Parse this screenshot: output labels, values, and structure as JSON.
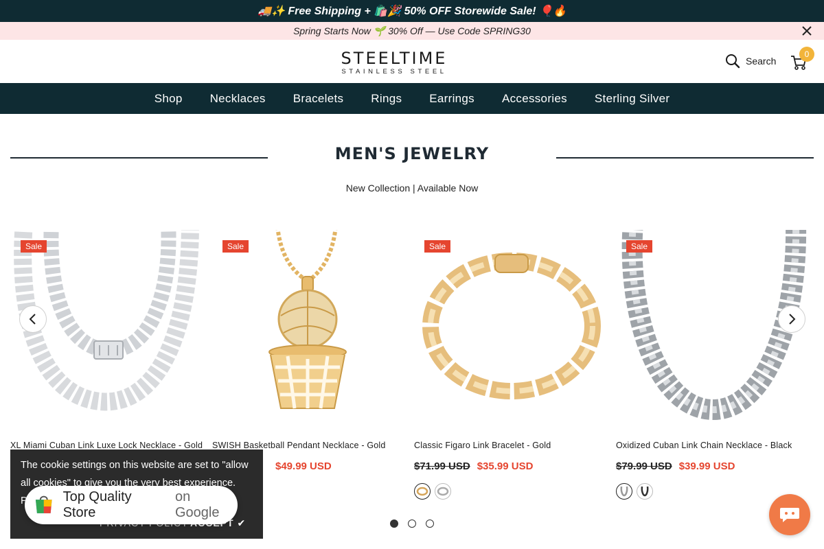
{
  "announcement": {
    "text": "🚚✨ Free Shipping + 🛍️🎉 50% OFF Storewide Sale! 🎈🔥"
  },
  "promo": {
    "text": "Spring Starts Now 🌱 30% Off — Use Code SPRING30"
  },
  "header": {
    "logo_main": "STEELTIME",
    "logo_sub": "STAINLESS STEEL",
    "search_label": "Search",
    "cart_count": "0"
  },
  "nav": {
    "items": [
      "Shop",
      "Necklaces",
      "Bracelets",
      "Rings",
      "Earrings",
      "Accessories",
      "Sterling Silver"
    ]
  },
  "section": {
    "title": "MEN'S JEWELRY",
    "subtitle": "New Collection | Available Now"
  },
  "products": [
    {
      "badge": "Sale",
      "name": "XL Miami Cuban Link Luxe Lock Necklace - Gold",
      "old_price": "",
      "new_price": ""
    },
    {
      "badge": "Sale",
      "name": "SWISH Basketball Pendant Necklace - Gold",
      "old_price": "",
      "new_price": "$49.99 USD"
    },
    {
      "badge": "Sale",
      "name": "Classic Figaro Link Bracelet - Gold",
      "old_price": "$71.99 USD",
      "new_price": "$35.99 USD"
    },
    {
      "badge": "Sale",
      "name": "Oxidized Cuban Link Chain Necklace - Black",
      "old_price": "$79.99 USD",
      "new_price": "$39.99 USD"
    }
  ],
  "carousel": {
    "pages": 3,
    "active_page": 1
  },
  "cookie": {
    "text": "The cookie settings on this website are set to \"allow all cookies\" to give you the very best experience. Please c",
    "privacy_label": "PRIVACY POLICY",
    "accept_label": "ACCEPT ✔"
  },
  "google_badge": {
    "title": "Top Quality Store",
    "suffix": "on Google"
  },
  "colors": {
    "dark_teal": "#0f2b33",
    "promo_pink": "#fde5e6",
    "sale_red": "#e5452f",
    "cart_badge": "#f2b43a",
    "chat_orange": "#f07a47"
  },
  "icons": {
    "search": "search-icon",
    "cart": "cart-icon",
    "close": "close-icon",
    "prev": "chevron-left-icon",
    "next": "chevron-right-icon",
    "chat": "chat-icon"
  }
}
